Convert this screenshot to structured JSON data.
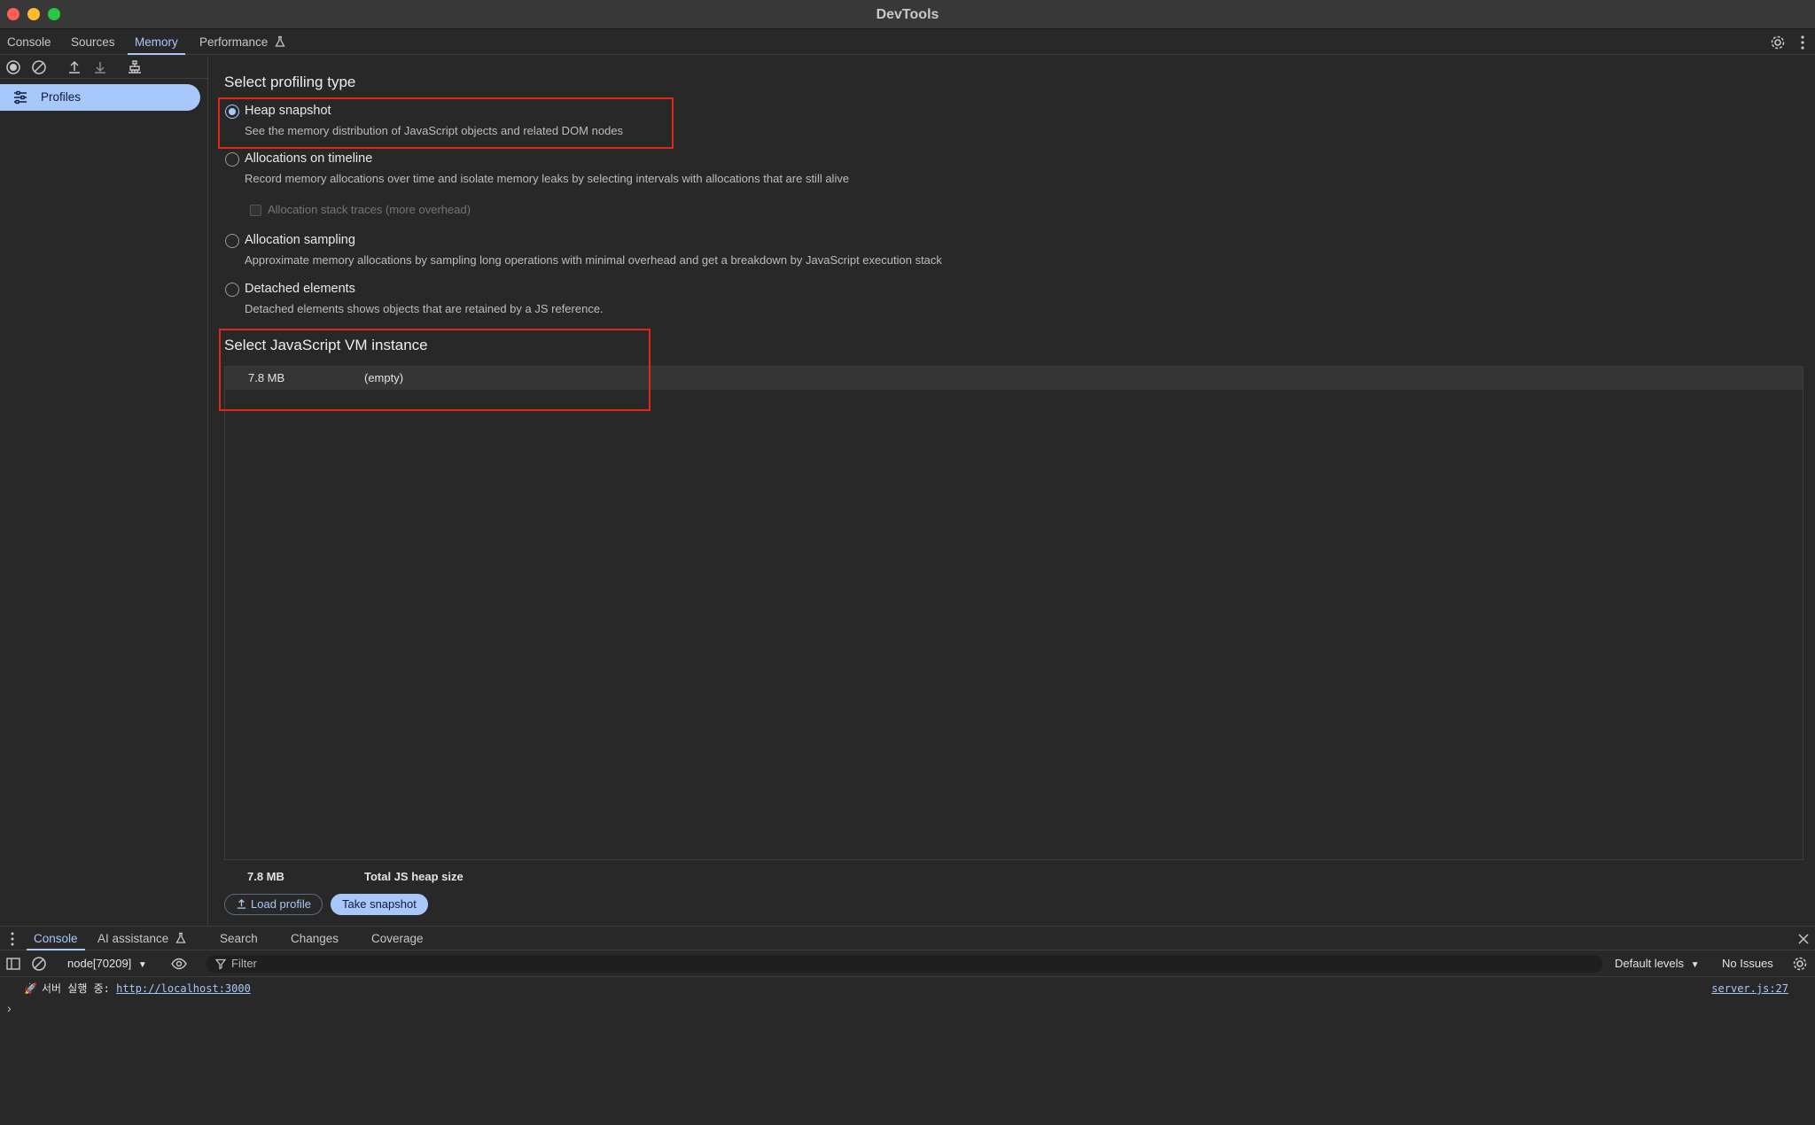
{
  "window": {
    "title": "DevTools"
  },
  "tabs": [
    {
      "label": "Console"
    },
    {
      "label": "Sources"
    },
    {
      "label": "Memory"
    },
    {
      "label": "Performance"
    }
  ],
  "sidebar": {
    "profiles_label": "Profiles"
  },
  "profiling": {
    "title": "Select profiling type",
    "options": [
      {
        "label": "Heap snapshot",
        "desc": "See the memory distribution of JavaScript objects and related DOM nodes",
        "checked": true
      },
      {
        "label": "Allocations on timeline",
        "desc": "Record memory allocations over time and isolate memory leaks by selecting intervals with allocations that are still alive",
        "checked": false
      },
      {
        "label": "Allocation sampling",
        "desc": "Approximate memory allocations by sampling long operations with minimal overhead and get a breakdown by JavaScript execution stack",
        "checked": false
      },
      {
        "label": "Detached elements",
        "desc": "Detached elements shows objects that are retained by a JS reference.",
        "checked": false
      }
    ],
    "stack_traces_label": "Allocation stack traces (more overhead)"
  },
  "vm": {
    "title": "Select JavaScript VM instance",
    "rows": [
      {
        "size": "7.8 MB",
        "name": "(empty)"
      }
    ]
  },
  "heap": {
    "size": "7.8 MB",
    "label": "Total JS heap size"
  },
  "buttons": {
    "load_profile": "Load profile",
    "take_snapshot": "Take snapshot"
  },
  "drawer": {
    "tabs": [
      {
        "label": "Console"
      },
      {
        "label": "AI assistance"
      },
      {
        "label": "Search"
      },
      {
        "label": "Changes"
      },
      {
        "label": "Coverage"
      }
    ]
  },
  "console": {
    "context": "node[70209]",
    "filter_placeholder": "Filter",
    "levels": "Default levels",
    "issues": "No Issues",
    "messages": [
      {
        "emoji": "🚀",
        "text": "서버 실행 중: ",
        "link": "http://localhost:3000",
        "source": "server.js:27"
      }
    ],
    "prompt": "›"
  },
  "colors": {
    "accent": "#a8c7fa",
    "highlight": "#e0271a",
    "background": "#282828"
  }
}
